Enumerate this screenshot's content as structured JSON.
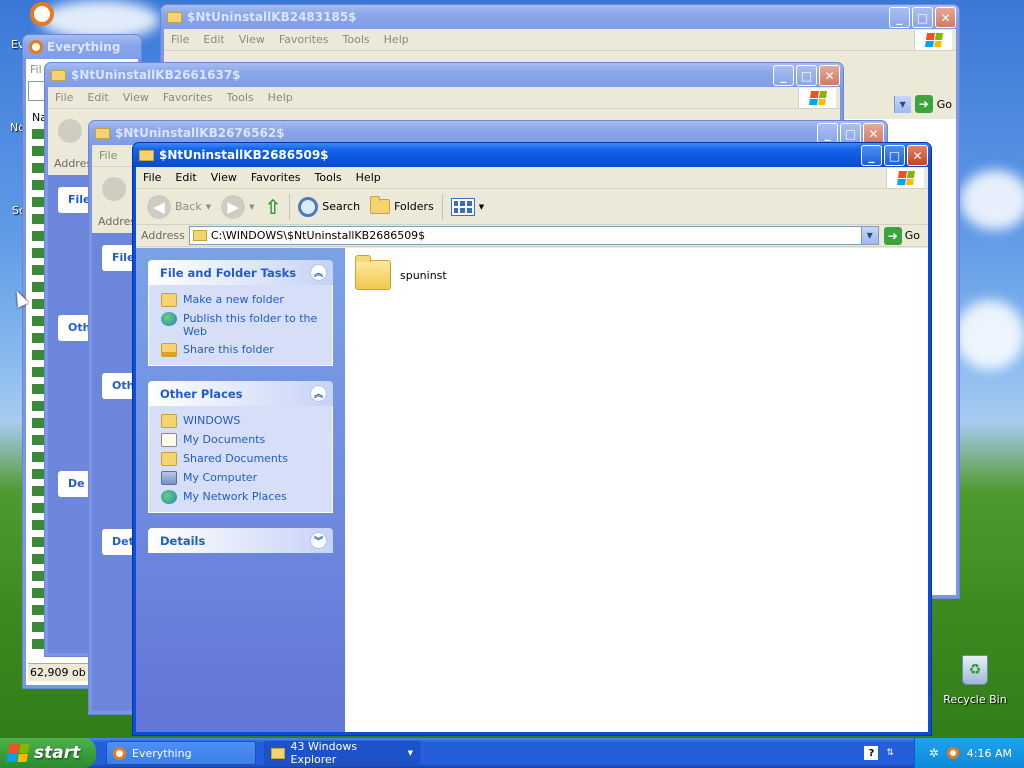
{
  "desktop": {
    "recycle_bin_label": "Recycle Bin",
    "everything_icon_label": "Ev",
    "partial_labels": [
      "No",
      "Sc"
    ]
  },
  "everything_window": {
    "title": "Everything",
    "status": "62,909 ob",
    "menu_partial": "Fil",
    "search_partial": "Na"
  },
  "windows_back": [
    {
      "title": "$NtUninstallKB2483185$",
      "menu": [
        "File",
        "Edit",
        "View",
        "Favorites",
        "Tools",
        "Help"
      ],
      "go_label": "Go"
    },
    {
      "title": "$NtUninstallKB2661637$",
      "menu": [
        "File",
        "Edit",
        "View",
        "Favorites",
        "Tools",
        "Help"
      ],
      "panel_partials": [
        "File",
        "Oth",
        "De"
      ],
      "address_partial": "Addres"
    },
    {
      "title": "$NtUninstallKB2676562$",
      "menu": [
        "File"
      ],
      "panel_partials": [
        "File",
        "Oth",
        "Det"
      ],
      "address_partial": "Addres"
    }
  ],
  "explorer": {
    "title": "$NtUninstallKB2686509$",
    "menu": {
      "file": "File",
      "edit": "Edit",
      "view": "View",
      "favorites": "Favorites",
      "tools": "Tools",
      "help": "Help"
    },
    "toolbar": {
      "back": "Back",
      "search": "Search",
      "folders": "Folders"
    },
    "address": {
      "label": "Address",
      "value": "C:\\WINDOWS\\$NtUninstallKB2686509$",
      "go": "Go"
    },
    "tasks_panel": {
      "title": "File and Folder Tasks",
      "items": [
        {
          "label": "Make a new folder",
          "icon": "new-folder-icon"
        },
        {
          "label": "Publish this folder to the Web",
          "icon": "publish-web-icon"
        },
        {
          "label": "Share this folder",
          "icon": "share-folder-icon"
        }
      ]
    },
    "places_panel": {
      "title": "Other Places",
      "items": [
        {
          "label": "WINDOWS",
          "icon": "folder-icon"
        },
        {
          "label": "My Documents",
          "icon": "my-documents-icon"
        },
        {
          "label": "Shared Documents",
          "icon": "shared-documents-icon"
        },
        {
          "label": "My Computer",
          "icon": "my-computer-icon"
        },
        {
          "label": "My Network Places",
          "icon": "network-places-icon"
        }
      ]
    },
    "details_panel": {
      "title": "Details"
    },
    "files": [
      {
        "name": "spuninst",
        "icon": "folder-icon"
      }
    ]
  },
  "taskbar": {
    "start_label": "start",
    "everything_btn": "Everything",
    "explorer_btn": "43 Windows Explorer",
    "clock": "4:16 AM"
  },
  "colors": {
    "xp_blue": "#0a4fd6",
    "task_link": "#215dc6",
    "start_green": "#39a03a"
  }
}
